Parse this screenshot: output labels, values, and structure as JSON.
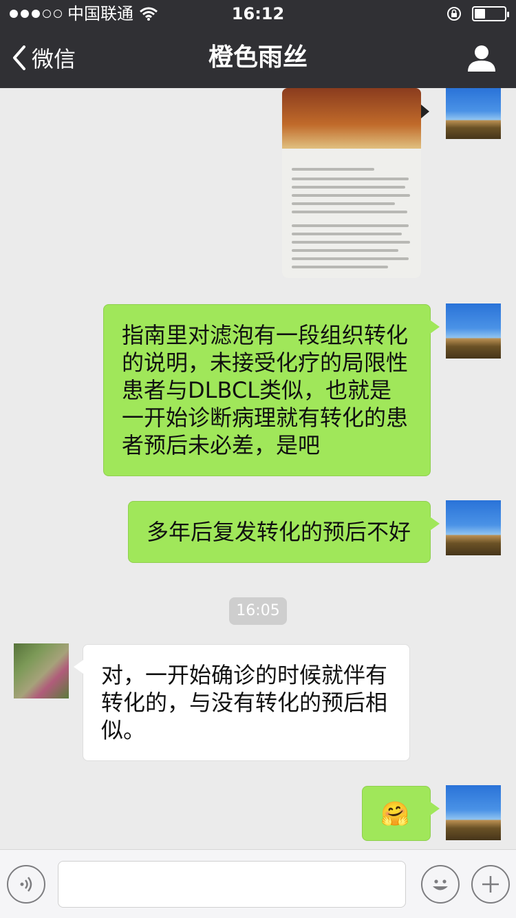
{
  "status_bar": {
    "carrier": "中国联通",
    "time": "16:12",
    "battery_level": 0.35
  },
  "nav": {
    "back_label": "微信",
    "title": "橙色雨丝"
  },
  "messages": [
    {
      "type": "image",
      "sender": "me"
    },
    {
      "type": "text",
      "sender": "me",
      "text": "指南里对滤泡有一段组织转化的说明，未接受化疗的局限性患者与DLBCL类似，也就是一开始诊断病理就有转化的患者预后未必差，是吧"
    },
    {
      "type": "text",
      "sender": "me",
      "text": "多年后复发转化的预后不好"
    },
    {
      "type": "timestamp",
      "text": "16:05"
    },
    {
      "type": "text",
      "sender": "friend",
      "text": "对，一开始确诊的时候就伴有转化的，与没有转化的预后相似。"
    },
    {
      "type": "emoji",
      "sender": "me",
      "text": "🤗"
    }
  ],
  "input_bar": {
    "voice_icon": "voice-icon",
    "text_value": "",
    "emoji_icon": "emoji-icon",
    "plus_icon": "plus-icon"
  },
  "colors": {
    "nav_bg": "#303034",
    "chat_bg": "#ebebeb",
    "my_bubble": "#a0e75a",
    "friend_bubble": "#ffffff"
  }
}
